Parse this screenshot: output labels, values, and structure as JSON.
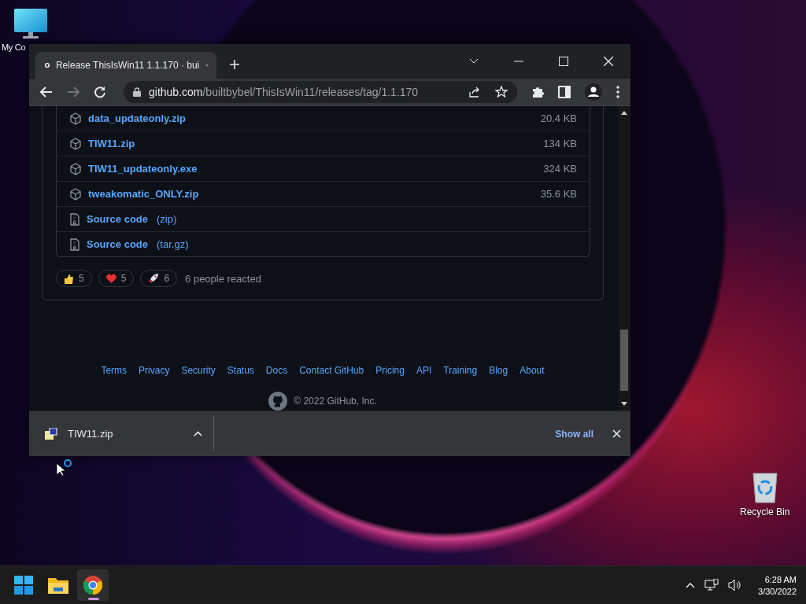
{
  "desktop_icons": [
    {
      "kind": "computer",
      "label": "My Co"
    },
    {
      "kind": "recycle",
      "label": "Recycle Bin"
    }
  ],
  "browser": {
    "tab": {
      "title": "Release ThisIsWin11 1.1.170 · bui",
      "selected": true
    },
    "url": {
      "host": "github.com",
      "path": "/builtbybel/ThisIsWin11/releases/tag/1.1.170"
    },
    "assets": [
      {
        "kind": "package",
        "name": "data_updateonly.zip",
        "size": "20.4 KB"
      },
      {
        "kind": "package",
        "name": "TIW11.zip",
        "size": "134 KB"
      },
      {
        "kind": "package",
        "name": "TIW11_updateonly.exe",
        "size": "324 KB"
      },
      {
        "kind": "package",
        "name": "tweakomatic_ONLY.zip",
        "size": "35.6 KB"
      },
      {
        "kind": "source",
        "name": "Source code",
        "ext": "(zip)"
      },
      {
        "kind": "source",
        "name": "Source code",
        "ext": "(tar.gz)"
      }
    ],
    "reactions": [
      {
        "kind": "thumbs-up",
        "count": "5"
      },
      {
        "kind": "heart",
        "count": "5"
      },
      {
        "kind": "rocket",
        "count": "6"
      }
    ],
    "reaction_summary": "6 people reacted",
    "footer_links": [
      "Terms",
      "Privacy",
      "Security",
      "Status",
      "Docs",
      "Contact GitHub",
      "Pricing",
      "API",
      "Training",
      "Blog",
      "About"
    ],
    "copyright": "© 2022 GitHub, Inc.",
    "download": {
      "file": "TIW11.zip",
      "show_all": "Show all"
    }
  },
  "taskbar": {
    "apps": [
      {
        "kind": "start",
        "selected": false
      },
      {
        "kind": "folder",
        "selected": false
      },
      {
        "kind": "browser",
        "selected": true
      }
    ],
    "time": "6:28 AM",
    "date": "3/30/2022"
  }
}
